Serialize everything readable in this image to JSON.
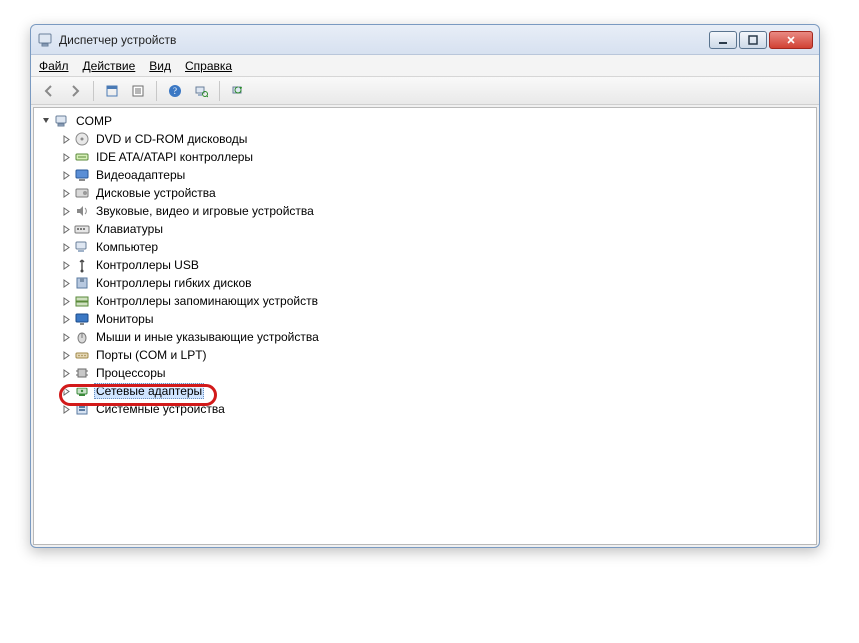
{
  "window": {
    "title": "Диспетчер устройств"
  },
  "menu": {
    "file": "Файл",
    "action": "Действие",
    "view": "Вид",
    "help": "Справка"
  },
  "tree": {
    "root": "COMP",
    "items": [
      {
        "icon": "disc",
        "label": "DVD и CD-ROM дисководы"
      },
      {
        "icon": "ide",
        "label": "IDE ATA/ATAPI контроллеры"
      },
      {
        "icon": "display",
        "label": "Видеоадаптеры"
      },
      {
        "icon": "drive",
        "label": "Дисковые устройства"
      },
      {
        "icon": "sound",
        "label": "Звуковые, видео и игровые устройства"
      },
      {
        "icon": "keyboard",
        "label": "Клавиатуры"
      },
      {
        "icon": "computer",
        "label": "Компьютер"
      },
      {
        "icon": "usb",
        "label": "Контроллеры USB"
      },
      {
        "icon": "floppy",
        "label": "Контроллеры гибких дисков"
      },
      {
        "icon": "storage",
        "label": "Контроллеры запоминающих устройств"
      },
      {
        "icon": "monitor",
        "label": "Мониторы"
      },
      {
        "icon": "mouse",
        "label": "Мыши и иные указывающие устройства"
      },
      {
        "icon": "port",
        "label": "Порты (COM и LPT)"
      },
      {
        "icon": "cpu",
        "label": "Процессоры"
      },
      {
        "icon": "network",
        "label": "Сетевые адаптеры",
        "selected": true
      },
      {
        "icon": "system",
        "label": "Системные устройства"
      }
    ]
  }
}
